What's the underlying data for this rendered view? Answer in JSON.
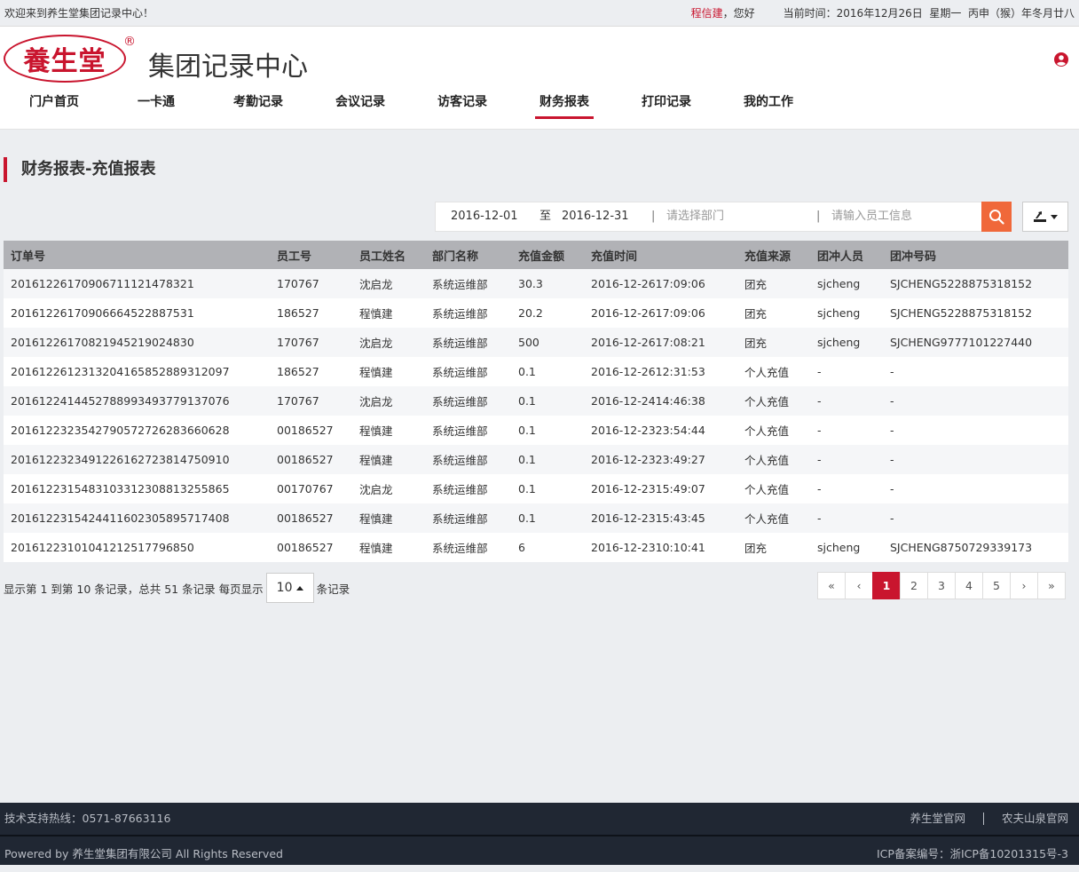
{
  "topbar": {
    "welcome": "欢迎来到养生堂集团记录中心！",
    "user_name": "程信建",
    "greeting": "，您好",
    "datetime": "当前时间：2016年12月26日  星期一  丙申（猴）年冬月廿八"
  },
  "header": {
    "logo_text": "養生堂",
    "reg_mark": "®",
    "site_title": "集团记录中心"
  },
  "nav": [
    {
      "label": "门户首页"
    },
    {
      "label": "一卡通"
    },
    {
      "label": "考勤记录"
    },
    {
      "label": "会议记录"
    },
    {
      "label": "访客记录"
    },
    {
      "label": "财务报表",
      "active": true
    },
    {
      "label": "打印记录"
    },
    {
      "label": "我的工作"
    }
  ],
  "page": {
    "title": "财务报表-充值报表"
  },
  "filter": {
    "start_date": "2016-12-01",
    "to_label": "至",
    "end_date": "2016-12-31",
    "sep": "|",
    "dept_placeholder": "请选择部门",
    "emp_placeholder": "请输入员工信息"
  },
  "table": {
    "columns": [
      "订单号",
      "员工号",
      "员工姓名",
      "部门名称",
      "充值金额",
      "充值时间",
      "充值来源",
      "团冲人员",
      "团冲号码"
    ],
    "rows": [
      [
        "20161226170906711121478321",
        "170767",
        "沈启龙",
        "系统运维部",
        "30.3",
        "2016-12-26 17:09:06",
        "团充",
        "sjcheng",
        "SJCHENG5228875318152"
      ],
      [
        "20161226170906664522887531",
        "186527",
        "程慎建",
        "系统运维部",
        "20.2",
        "2016-12-26 17:09:06",
        "团充",
        "sjcheng",
        "SJCHENG5228875318152"
      ],
      [
        "20161226170821945219024830",
        "170767",
        "沈启龙",
        "系统运维部",
        "500",
        "2016-12-26 17:08:21",
        "团充",
        "sjcheng",
        "SJCHENG9777101227440"
      ],
      [
        "201612261231320416585288931 2097",
        "186527",
        "程慎建",
        "系统运维部",
        "0.1",
        "2016-12-26 12:31:53",
        "个人充值",
        "-",
        "-"
      ],
      [
        "20161224144527889934937791 37076",
        "170767",
        "沈启龙",
        "系统运维部",
        "0.1",
        "2016-12-24 14:46:38",
        "个人充值",
        "-",
        "-"
      ],
      [
        "20161223235427905727262836 60628",
        "00186527",
        "程慎建",
        "系统运维部",
        "0.1",
        "2016-12-23 23:54:44",
        "个人充值",
        "-",
        "-"
      ],
      [
        "20161223234912261627238147 50910",
        "00186527",
        "程慎建",
        "系统运维部",
        "0.1",
        "2016-12-23 23:49:27",
        "个人充值",
        "-",
        "-"
      ],
      [
        "20161223154831033123088132 55865",
        "00170767",
        "沈启龙",
        "系统运维部",
        "0.1",
        "2016-12-23 15:49:07",
        "个人充值",
        "-",
        "-"
      ],
      [
        "20161223154244116023058957 17408",
        "00186527",
        "程慎建",
        "系统运维部",
        "0.1",
        "2016-12-23 15:43:45",
        "个人充值",
        "-",
        "-"
      ],
      [
        "20161223101041212517796850",
        "00186527",
        "程慎建",
        "系统运维部",
        "6",
        "2016-12-23 10:10:41",
        "团充",
        "sjcheng",
        "SJCHENG8750729339173"
      ]
    ]
  },
  "pager": {
    "info_prefix": "显示第 1 到第 10 条记录，总共 51 条记录 每页显示",
    "page_size": "10",
    "info_suffix": "条记录",
    "pages": [
      "«",
      "‹",
      "1",
      "2",
      "3",
      "4",
      "5",
      "›",
      "»"
    ],
    "active_page": "1"
  },
  "footer": {
    "support": "技术支持热线：0571-87663116",
    "link1": "养生堂官网",
    "link2": "农夫山泉官网",
    "copyright": "Powered by 养生堂集团有限公司 All Rights Reserved",
    "icp": "ICP备案编号：浙ICP备10201315号-3"
  },
  "colors": {
    "brand_red": "#c9152e",
    "search_orange": "#f0683a",
    "footer_bg": "#202733",
    "header_row": "#b1b2b6"
  },
  "icons": {
    "user": "user-circle-icon",
    "search": "search-icon",
    "export": "export-icon"
  }
}
